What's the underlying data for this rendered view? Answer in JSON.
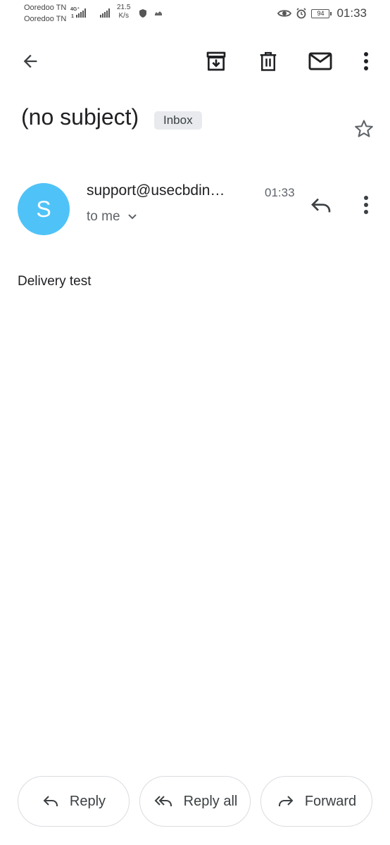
{
  "status_bar": {
    "carrier_1": "Ooredoo TN",
    "carrier_2": "Ooredoo TN",
    "network_type": "4G⁺",
    "sim2_tag": "1",
    "speed_value": "21.5",
    "speed_unit": "K/s",
    "battery": "94",
    "time": "01:33"
  },
  "toolbar": {
    "back_icon": "arrow-left-icon",
    "archive_icon": "archive-icon",
    "delete_icon": "trash-icon",
    "mark_unread_icon": "mail-icon",
    "more_icon": "more-vert-icon"
  },
  "message": {
    "subject": "(no subject)",
    "label": "Inbox",
    "starred": false,
    "sender_initial": "S",
    "avatar_color": "#4fc3f7",
    "sender": "support@usecbdin…",
    "time": "01:33",
    "recipients": "to me",
    "body": "Delivery test"
  },
  "actions": {
    "reply": "Reply",
    "reply_all": "Reply all",
    "forward": "Forward"
  }
}
